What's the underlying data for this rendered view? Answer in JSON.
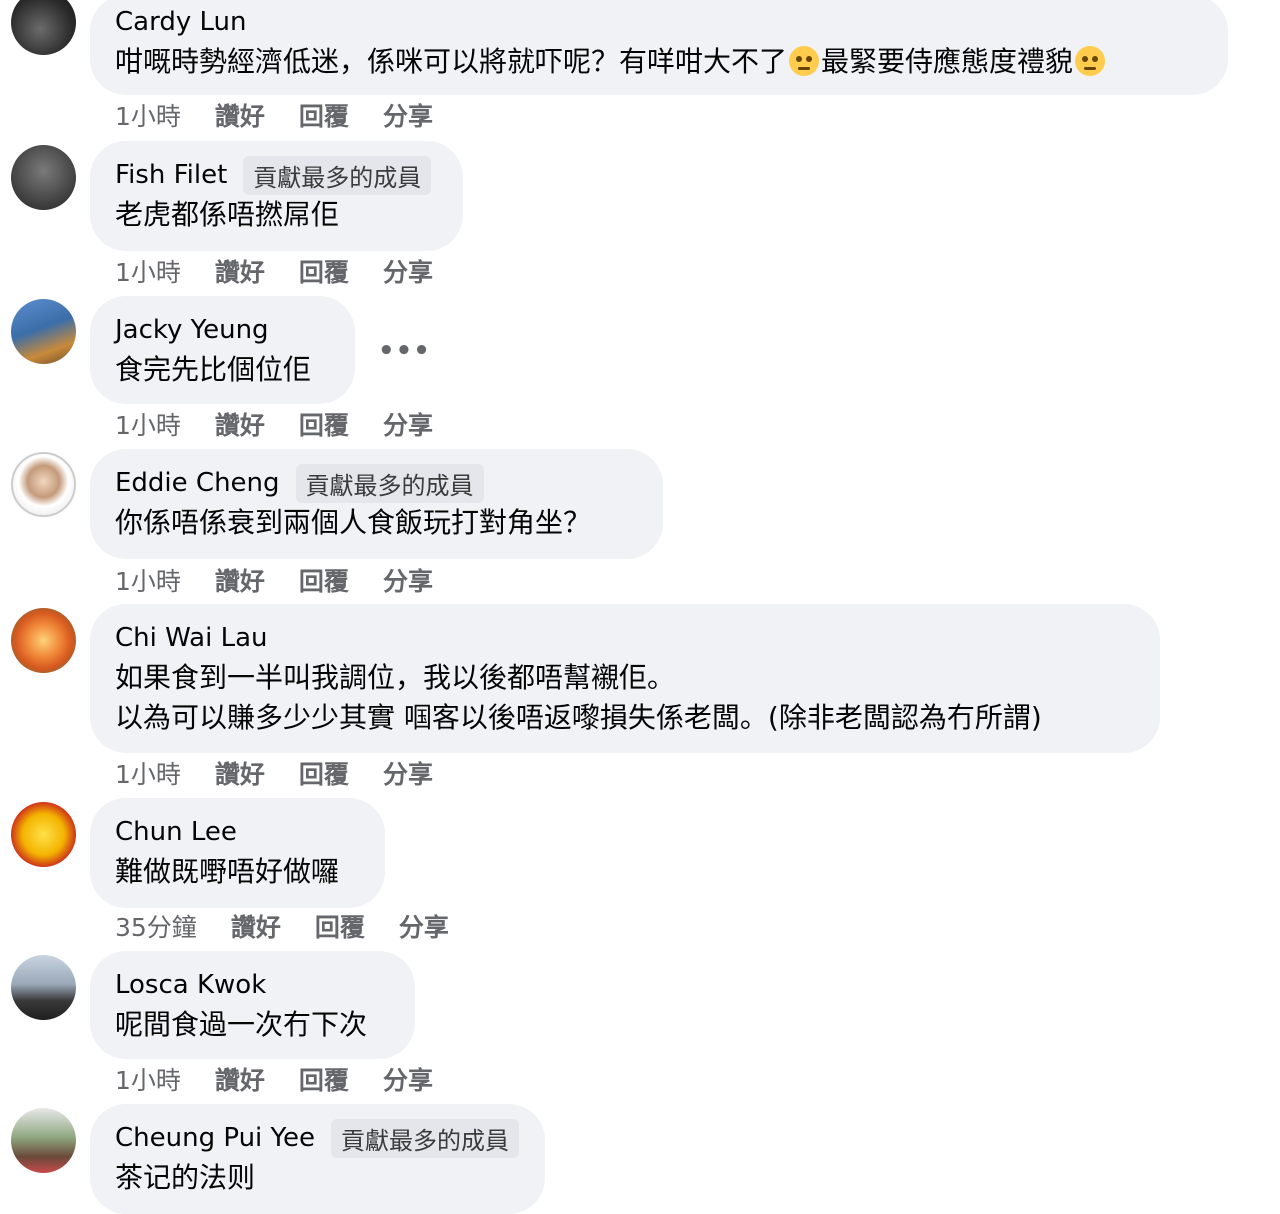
{
  "comments": [
    {
      "name": "Cardy Lun",
      "badge": "",
      "lines": [
        "咁嘅時勢經濟低迷，係咪可以將就吓呢？有咩咁大不了",
        "最緊要侍應態度禮貌"
      ],
      "time": "1小時",
      "avatar_color": "#2a2a2a"
    },
    {
      "name": "Fish Filet",
      "badge": "貢獻最多的成員",
      "lines": [
        "老虎都係唔撚屌佢"
      ],
      "time": "1小時",
      "avatar_color": "#4a4a4a"
    },
    {
      "name": "Jacky Yeung",
      "badge": "",
      "lines": [
        "食完先比個位佢"
      ],
      "time": "1小時",
      "avatar_color": "#3b6ea8"
    },
    {
      "name": "Eddie Cheng",
      "badge": "貢獻最多的成員",
      "lines": [
        "你係唔係衰到兩個人食飯玩打對角坐？"
      ],
      "time": "1小時",
      "avatar_color": "#d8d8d8"
    },
    {
      "name": "Chi Wai Lau",
      "badge": "",
      "lines": [
        "如果食到一半叫我調位，我以後都唔幫襯佢。",
        "以為可以賺多少少其實 啯客以後唔返嚟損失係老闆。(除非老闆認為冇所謂)"
      ],
      "time": "1小時",
      "avatar_color": "#e86a2c"
    },
    {
      "name": "Chun Lee",
      "badge": "",
      "lines": [
        "難做既嘢唔好做囉"
      ],
      "time": "35分鐘",
      "avatar_color": "#f3b400"
    },
    {
      "name": "Losca Kwok",
      "badge": "",
      "lines": [
        "呢間食過一次冇下次"
      ],
      "time": "1小時",
      "avatar_color": "#7a8ea8"
    },
    {
      "name": "Cheung Pui Yee",
      "badge": "貢獻最多的成員",
      "lines": [
        "茶记的法则"
      ],
      "time": "",
      "avatar_color": "#8fa880"
    }
  ],
  "actions": {
    "like": "讚好",
    "reply": "回覆",
    "share": "分享"
  },
  "more_menu": "•••"
}
